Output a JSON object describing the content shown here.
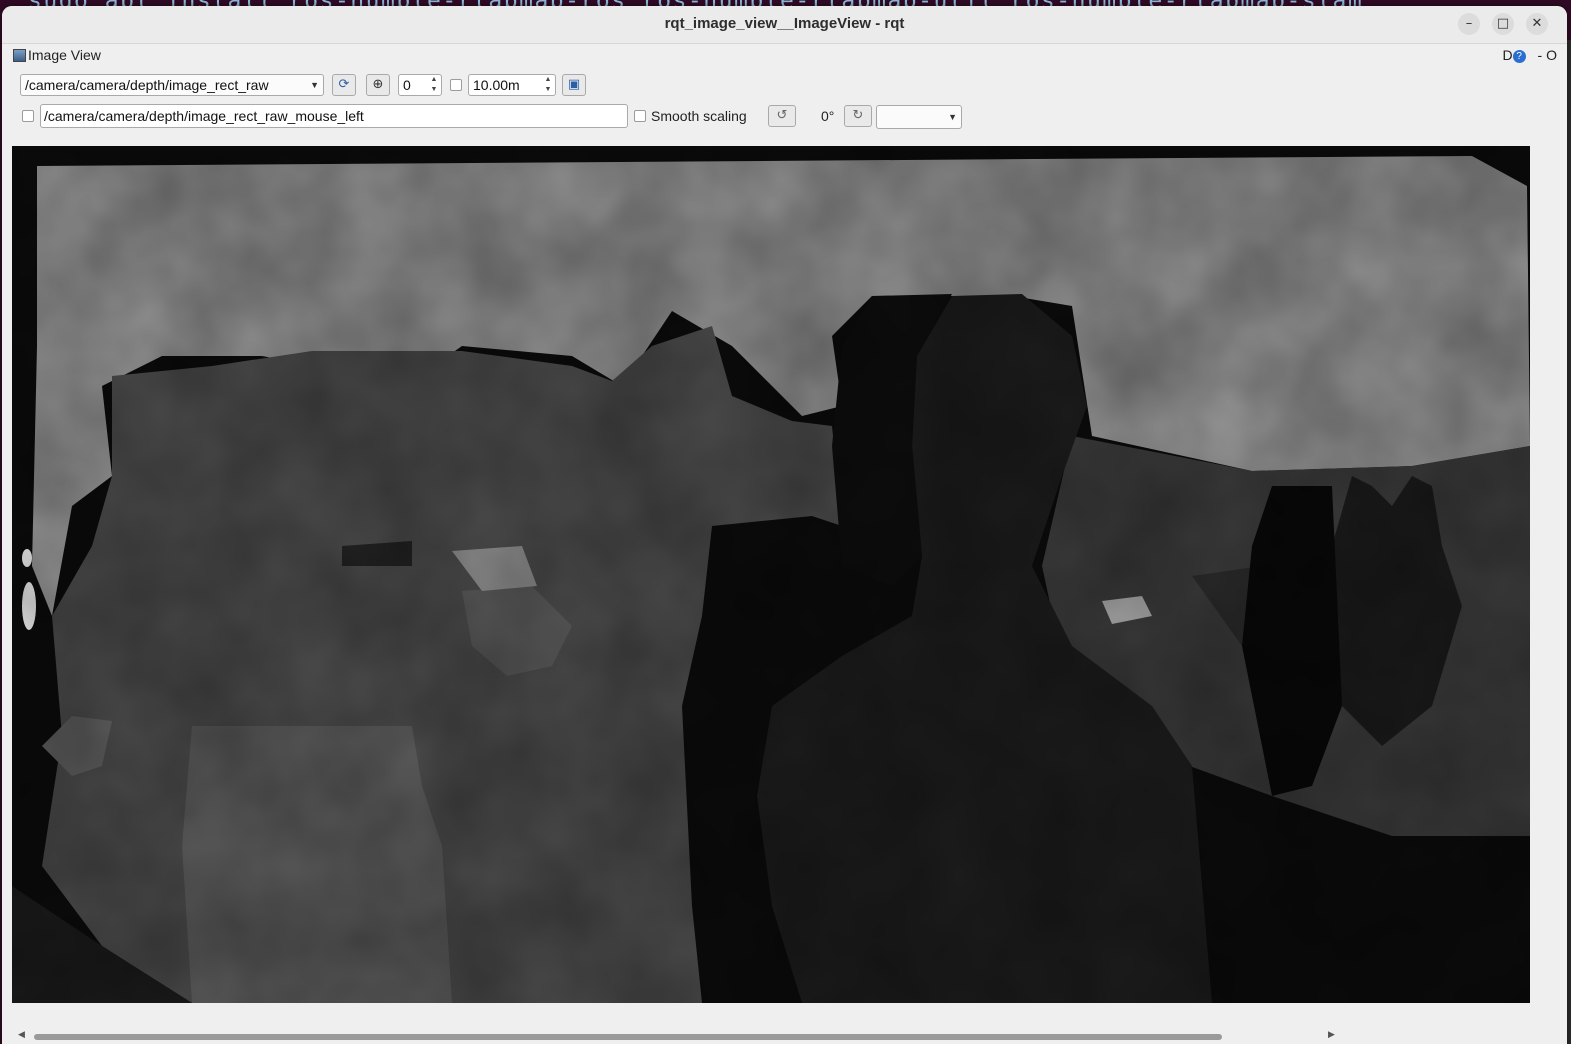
{
  "background_terminal": {
    "text": "sudo apt install ros-humble-rtabmap-ros ros-humble-rtabmap-util ros-humble-rtabmap-slam"
  },
  "window": {
    "title": "rqt_image_view__ImageView - rqt",
    "minimize_label": "–",
    "maximize_label": "□",
    "close_label": "✕"
  },
  "dock": {
    "title": "Image View",
    "right_controls": "D",
    "help_symbol": "?",
    "extra": "- O"
  },
  "toolbar": {
    "topic": "/camera/camera/depth/image_rect_raw",
    "min_value": "0",
    "max_value": "10.00m",
    "mouse_topic": "/camera/camera/depth/image_rect_raw_mouse_left",
    "smooth_scaling_label": "Smooth scaling",
    "rotation_label": "0°",
    "rotation_select": ""
  },
  "icons": {
    "refresh": "refresh-icon",
    "zoom": "zoom-icon",
    "save": "save-icon",
    "rotate_left": "rotate-left-icon",
    "rotate_right": "rotate-right-icon"
  },
  "colors": {
    "terminal_bg": "#300a24",
    "window_bg": "#efefef",
    "image_bg": "#0a0a0a"
  }
}
